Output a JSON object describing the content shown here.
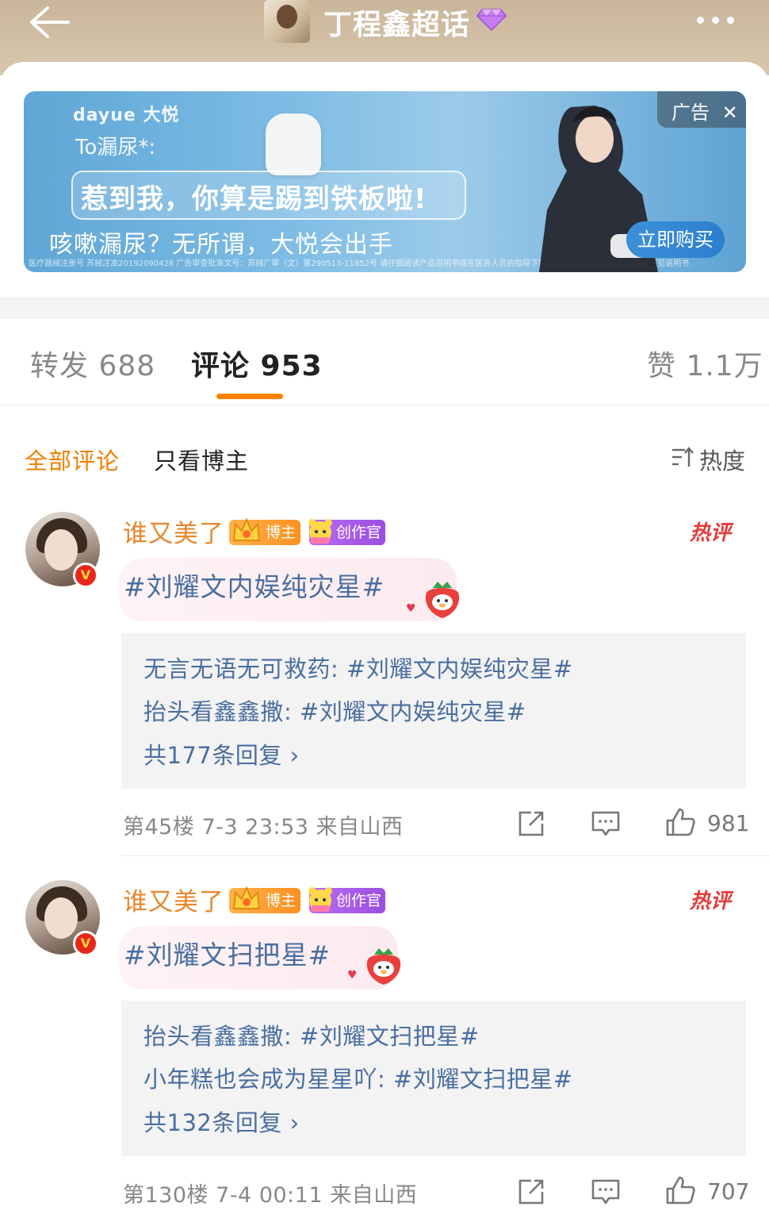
{
  "topbar": {
    "title": "丁程鑫超话",
    "back_icon": "back-arrow-icon",
    "more_icon": "more-dots-icon"
  },
  "ad": {
    "brand": "dayue 大悦",
    "subtitle": "To漏尿*:",
    "headline": "惹到我，你算是踢到铁板啦!",
    "slogan": "咳嗽漏尿？无所谓，大悦会出手",
    "fine_print": "医疗器械注册号 苏械注准20192090428    广告审查批准文号：苏械广审（文）第290513-11852号    请仔细阅读产品说明书或在医务人员的指导下购买和使用禁忌内容或注意事项详见说明书",
    "label": "广告",
    "close_icon": "close-icon",
    "buy_button": "立即购买"
  },
  "tabs": [
    {
      "label": "转发 688"
    },
    {
      "label": "评论 953"
    },
    {
      "label": "赞 1.1万"
    }
  ],
  "filter": {
    "all": "全部评论",
    "host_only": "只看博主",
    "sort": "热度"
  },
  "comments": [
    {
      "user": "谁又美了",
      "badge_host": "博主",
      "badge_creator": "创作官",
      "hot": "热评",
      "text": "#刘耀文内娱纯灾星#",
      "replies": [
        {
          "user": "无言无语无可救药",
          "text": "#刘耀文内娱纯灾星#"
        },
        {
          "user": "抬头看鑫鑫撒",
          "text": "#刘耀文内娱纯灾星#"
        }
      ],
      "reply_more": "共177条回复 ›",
      "floor": "第45楼",
      "time": "7-3 23:53",
      "location": "来自山西",
      "likes": "981"
    },
    {
      "user": "谁又美了",
      "badge_host": "博主",
      "badge_creator": "创作官",
      "hot": "热评",
      "text": "#刘耀文扫把星#",
      "replies": [
        {
          "user": "抬头看鑫鑫撒",
          "text": "#刘耀文扫把星#"
        },
        {
          "user": "小年糕也会成为星星吖",
          "text": "#刘耀文扫把星#"
        }
      ],
      "reply_more": "共132条回复 ›",
      "floor": "第130楼",
      "time": "7-4 00:11",
      "location": "来自山西",
      "likes": "707"
    }
  ],
  "colors": {
    "accent": "#ff8200",
    "link": "#4a6ea0",
    "username": "#e9862b",
    "hot": "#e33b3b"
  }
}
